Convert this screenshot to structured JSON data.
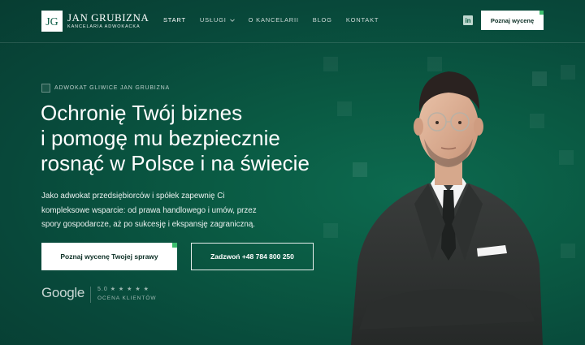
{
  "brand": {
    "name": "JAN GRUBIZNA",
    "subtitle": "KANCELARIA ADWOKACKA",
    "monogram": "JG"
  },
  "nav": {
    "items": [
      {
        "label": "START",
        "active": true
      },
      {
        "label": "USŁUGI",
        "has_dropdown": true
      },
      {
        "label": "O KANCELARII"
      },
      {
        "label": "BLOG"
      },
      {
        "label": "KONTAKT"
      }
    ],
    "social_icon": "linkedin-icon",
    "cta": "Poznaj wycenę"
  },
  "hero": {
    "eyebrow": "ADWOKAT GLIWICE JAN GRUBIZNA",
    "headline": [
      "Ochronię Twój biznes",
      "i pomogę mu bezpiecznie",
      "rosnąć w Polsce i na świecie"
    ],
    "description": [
      "Jako adwokat przedsiębiorców i spółek zapewnię Ci",
      "kompleksowe wsparcie: od prawa handlowego i umów, przez",
      "spory gospodarcze, aż po sukcesję i ekspansję zagraniczną."
    ],
    "primary_button": "Poznaj wycenę Twojej sprawy",
    "call_button": "Zadzwoń +48 784 800 250"
  },
  "reviews": {
    "provider": "Google",
    "score": "5.0",
    "stars": "★ ★ ★ ★ ★",
    "label": "OCENA KLIENTÓW"
  },
  "colors": {
    "background": "#0a5a43",
    "accent": "#3cbf6e",
    "button_text": "#0b2e24"
  }
}
